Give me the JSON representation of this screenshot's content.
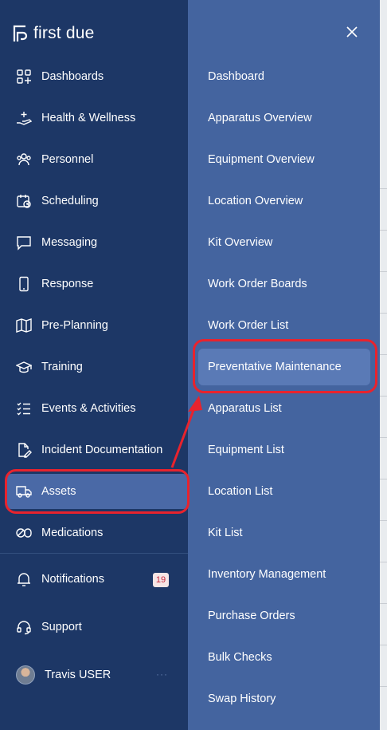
{
  "brand": {
    "name": "first due"
  },
  "nav": {
    "items": [
      {
        "label": "Dashboards",
        "icon": "dashboard-grid-icon"
      },
      {
        "label": "Health & Wellness",
        "icon": "hand-health-icon"
      },
      {
        "label": "Personnel",
        "icon": "people-icon"
      },
      {
        "label": "Scheduling",
        "icon": "calendar-clock-icon"
      },
      {
        "label": "Messaging",
        "icon": "chat-bubble-icon"
      },
      {
        "label": "Response",
        "icon": "phone-icon"
      },
      {
        "label": "Pre-Planning",
        "icon": "map-icon"
      },
      {
        "label": "Training",
        "icon": "graduation-cap-icon"
      },
      {
        "label": "Events & Activities",
        "icon": "checklist-icon"
      },
      {
        "label": "Incident Documentation",
        "icon": "document-edit-icon"
      },
      {
        "label": "Assets",
        "icon": "truck-icon",
        "active": true
      },
      {
        "label": "Medications",
        "icon": "pill-icon"
      }
    ],
    "notifications": {
      "label": "Notifications",
      "count": "19"
    },
    "support": {
      "label": "Support"
    },
    "user": {
      "name": "Travis USER",
      "more": "···"
    }
  },
  "submenu": {
    "items": [
      "Dashboard",
      "Apparatus Overview",
      "Equipment Overview",
      "Location Overview",
      "Kit Overview",
      "Work Order Boards",
      "Work Order List",
      "Preventative Maintenance",
      "Apparatus List",
      "Equipment List",
      "Location List",
      "Kit List",
      "Inventory Management",
      "Purchase Orders",
      "Bulk Checks",
      "Swap History"
    ],
    "active": "Preventative Maintenance"
  },
  "colors": {
    "nav_bg": "#1d3766",
    "submenu_bg": "#44649f",
    "active_bg": "#4a69a6",
    "annotation": "#e8232d"
  }
}
